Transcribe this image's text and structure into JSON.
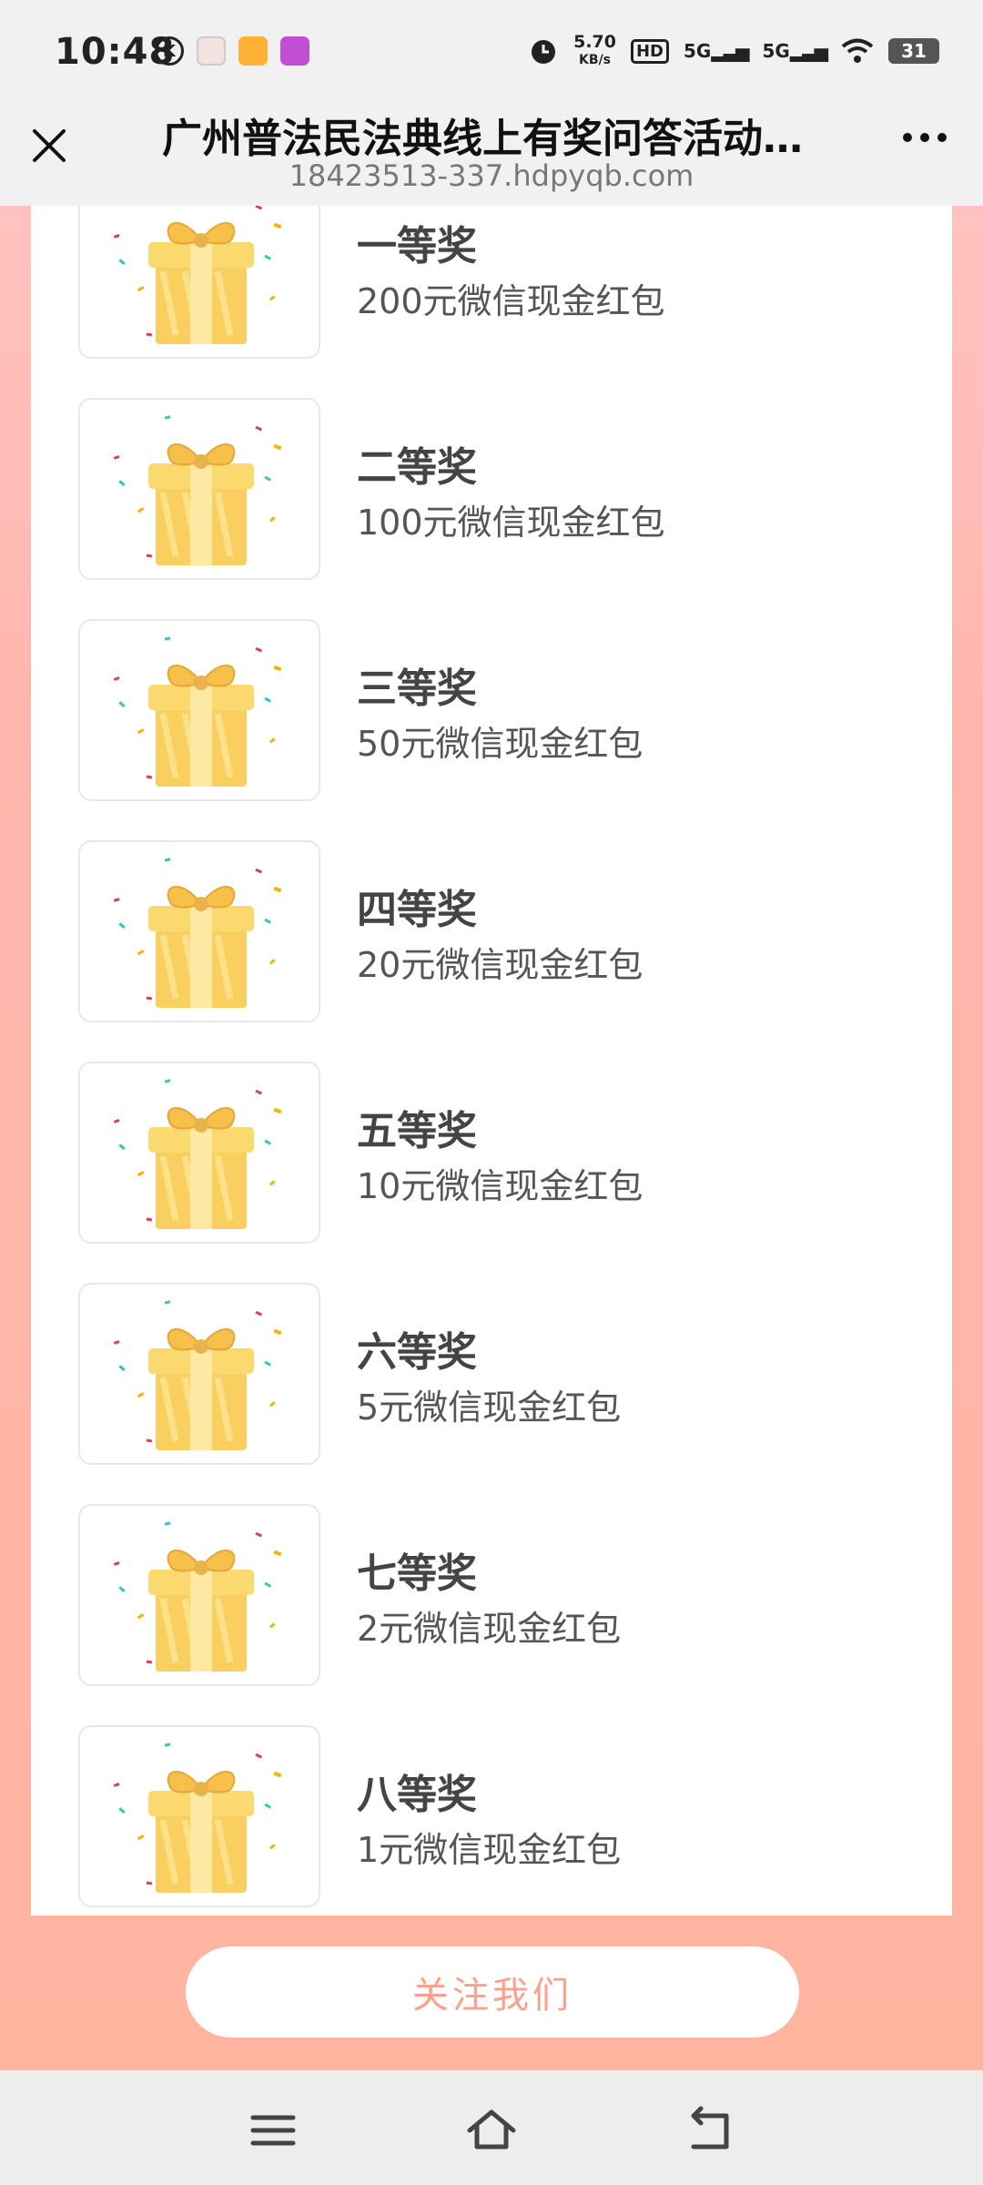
{
  "status_bar": {
    "time": "10:48",
    "net_speed_value": "5.70",
    "net_speed_unit": "KB/s",
    "hd_label": "HD",
    "sim1_label": "5G",
    "sim2_label": "5G",
    "battery": "31",
    "k_icon_label": "K"
  },
  "title_bar": {
    "title": "广州普法民法典线上有奖问答活动…",
    "url": "18423513-337.hdpyqb.com"
  },
  "prizes": [
    {
      "name": "一等奖",
      "desc": "200元微信现金红包"
    },
    {
      "name": "二等奖",
      "desc": "100元微信现金红包"
    },
    {
      "name": "三等奖",
      "desc": "50元微信现金红包"
    },
    {
      "name": "四等奖",
      "desc": "20元微信现金红包"
    },
    {
      "name": "五等奖",
      "desc": "10元微信现金红包"
    },
    {
      "name": "六等奖",
      "desc": "5元微信现金红包"
    },
    {
      "name": "七等奖",
      "desc": "2元微信现金红包"
    },
    {
      "name": "八等奖",
      "desc": "1元微信现金红包"
    }
  ],
  "follow_button": "关注我们",
  "colors": {
    "accent": "#ff9f8c",
    "page_gradient_top": "#ffc2bf",
    "page_gradient_bottom": "#ffb4a0",
    "gift_gold": "#f9cf5f"
  },
  "icons": {
    "close": "close-icon",
    "more": "more-dots-icon",
    "gift": "gift-box-icon",
    "nav_menu": "menu-icon",
    "nav_home": "home-icon",
    "nav_back": "back-icon"
  }
}
